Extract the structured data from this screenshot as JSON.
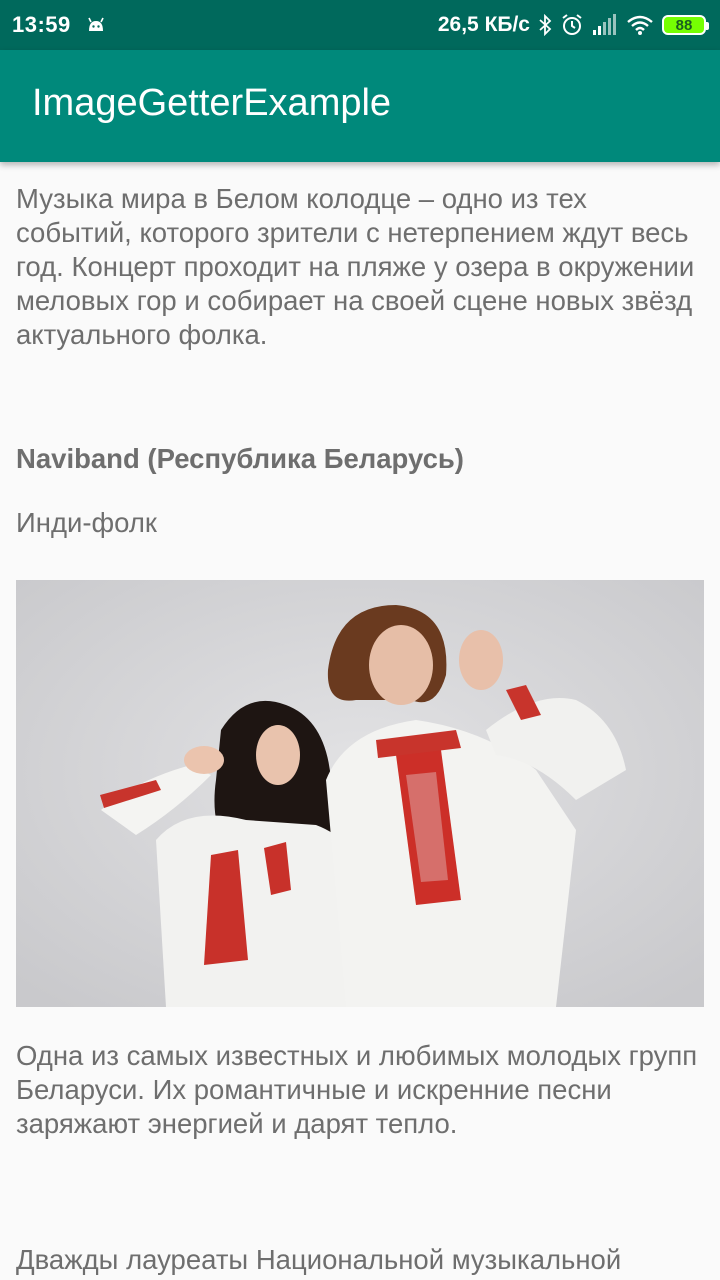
{
  "status_bar": {
    "time": "13:59",
    "net_speed": "26,5 КБ/с",
    "battery": "88",
    "icons": [
      "android-icon",
      "bluetooth-icon",
      "alarm-icon",
      "signal-icon",
      "wifi-icon",
      "battery-icon"
    ]
  },
  "app_bar": {
    "title": "ImageGetterExample"
  },
  "article": {
    "intro": "Музыка мира в Белом колодце – одно из тех событий, которого зрители с нетерпением ждут весь год. Концерт проходит на пляже у озера в окружении меловых гор и собирает на своей сцене новых звёзд актуального фолка.",
    "band_name": "Naviband (Республика Беларусь)",
    "genre": "Инди-фолк",
    "description": "Одна из самых известных и любимых молодых групп Беларуси. Их романтичные и искренние песни заряжают энергией и дарят тепло.",
    "laureates": "Дважды лауреаты Национальной музыкальной"
  },
  "colors": {
    "status_bar": "#00695c",
    "app_bar": "#00897b",
    "text": "#6e6e6e",
    "background": "#fafafa"
  }
}
